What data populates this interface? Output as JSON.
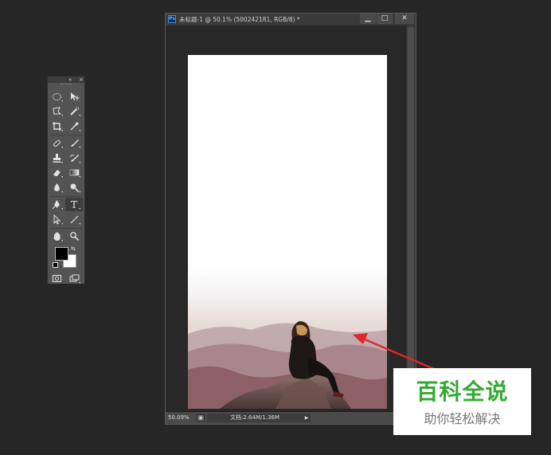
{
  "tools_panel": {
    "collapse_label": "«",
    "close_label": "×",
    "rows": [
      [
        {
          "name": "marquee-tool-icon"
        },
        {
          "name": "move-tool-icon"
        }
      ],
      [
        {
          "name": "lasso-tool-icon"
        },
        {
          "name": "quick-select-tool-icon"
        }
      ],
      [
        {
          "name": "crop-tool-icon"
        },
        {
          "name": "eyedropper-tool-icon"
        }
      ],
      [
        {
          "name": "healing-brush-tool-icon"
        },
        {
          "name": "brush-tool-icon"
        }
      ],
      [
        {
          "name": "clone-stamp-tool-icon"
        },
        {
          "name": "history-brush-tool-icon"
        }
      ],
      [
        {
          "name": "eraser-tool-icon"
        },
        {
          "name": "gradient-tool-icon"
        }
      ],
      [
        {
          "name": "blur-tool-icon"
        },
        {
          "name": "dodge-tool-icon"
        }
      ],
      [
        {
          "name": "pen-tool-icon"
        },
        {
          "name": "type-tool-icon"
        }
      ],
      [
        {
          "name": "path-selection-tool-icon"
        },
        {
          "name": "line-tool-icon"
        }
      ],
      [
        {
          "name": "hand-tool-icon"
        },
        {
          "name": "zoom-tool-icon"
        }
      ]
    ],
    "type_tool_glyph": "T",
    "swap_glyph": "⇆",
    "foreground_color": "#000000",
    "background_color": "#ffffff"
  },
  "document": {
    "ps_badge": "Ps",
    "title": "未标题-1 @ 50.1% (500242181, RGB/8) *",
    "minimize_label": "▁",
    "maximize_label": "□",
    "close_label": "✕"
  },
  "statusbar": {
    "zoom": "50.09%",
    "info": "文档:2.64M/1.36M",
    "play_label": "▶"
  },
  "watermark": {
    "main": "百科全说",
    "sub": "助你轻松解决",
    "main_color": "#33aa33"
  },
  "arrow_color": "#e0262b"
}
